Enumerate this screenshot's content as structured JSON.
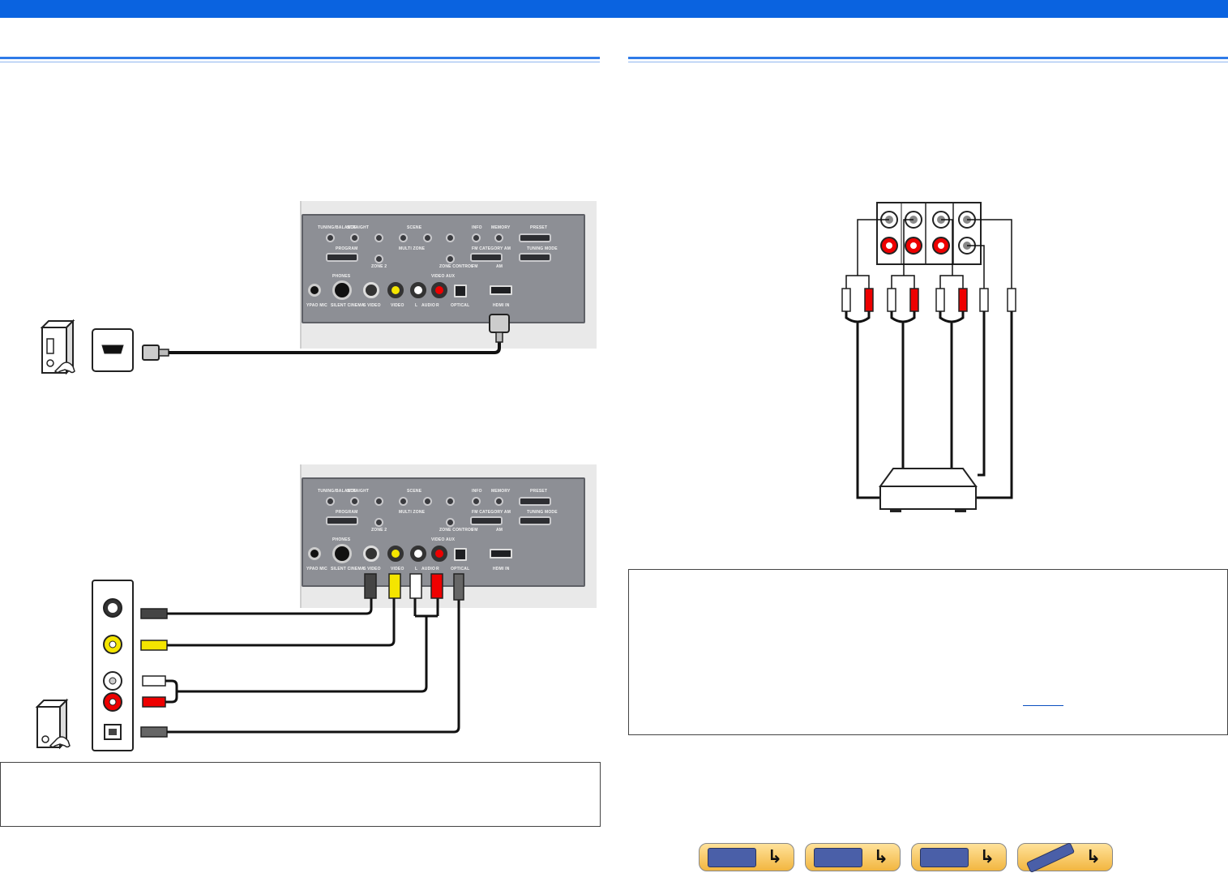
{
  "colors": {
    "header_bar": "#0a63e0",
    "section_rule": "#2f7be8",
    "cable": "#111111",
    "jack_yellow": "#f4e500",
    "jack_red": "#e00000",
    "jack_white": "#ffffff",
    "nav_button": "#f2b640"
  },
  "receiver_panel": {
    "labels": {
      "tuning_balance": "TUNING/BALANCE",
      "straight": "STRAIGHT",
      "scene": "SCENE",
      "info": "INFO",
      "memory": "MEMORY",
      "preset": "PRESET",
      "program": "PROGRAM",
      "multi_zone": "MULTI ZONE",
      "zone2": "ZONE 2",
      "zone_control": "ZONE CONTROL",
      "fm_am_category": "FM CATEGORY AM",
      "fm": "FM",
      "am": "AM",
      "tuning_mode": "TUNING MODE",
      "phones": "PHONES",
      "silent_cinema": "SILENT CINEMA",
      "video_aux": "VIDEO AUX",
      "s_video": "S VIDEO",
      "video": "VIDEO",
      "l": "L",
      "audio": "AUDIO",
      "r": "R",
      "optical": "OPTICAL",
      "hdmi_in": "HDMI IN",
      "ypao_mic": "YPAO MIC"
    }
  },
  "navigation": {
    "buttons": [
      {
        "icon": "front-panel-icon"
      },
      {
        "icon": "rear-panel-icon"
      },
      {
        "icon": "display-icon"
      },
      {
        "icon": "remote-control-icon"
      }
    ]
  }
}
